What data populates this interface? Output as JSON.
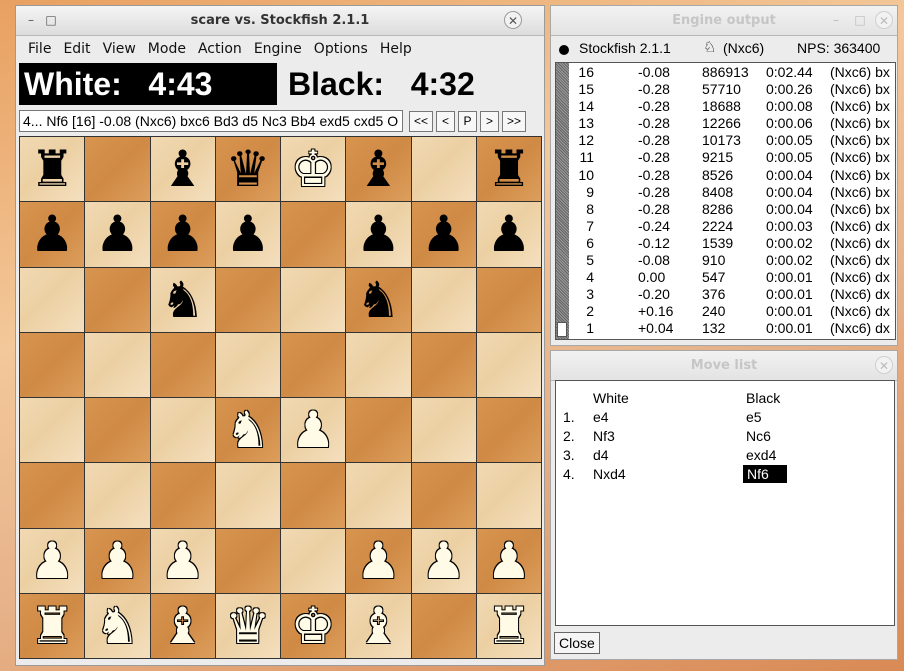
{
  "main_window": {
    "title": "scare vs. Stockfish 2.1.1",
    "menu": [
      "File",
      "Edit",
      "View",
      "Mode",
      "Action",
      "Engine",
      "Options",
      "Help"
    ],
    "white_clock": "White:   4:43",
    "black_clock": "Black:   4:32",
    "info_line": "4... Nf6  [16] -0.08  (Nxc6) bxc6 Bd3 d5 Nc3 Bb4 exd5 cxd5 O",
    "nav_buttons": [
      "<<",
      "<",
      "P",
      ">",
      ">>"
    ]
  },
  "board": {
    "ranks": [
      [
        "br",
        "",
        "bb",
        "bq",
        "wk_black_king",
        "bb",
        "",
        "br"
      ],
      [
        "bp",
        "bp",
        "bp",
        "bp",
        "",
        "bp",
        "bp",
        "bp"
      ],
      [
        "",
        "",
        "bn",
        "",
        "",
        "bn",
        "",
        ""
      ],
      [
        "",
        "",
        "",
        "",
        "",
        "",
        "",
        ""
      ],
      [
        "",
        "",
        "",
        "wn",
        "wp",
        "",
        "",
        ""
      ],
      [
        "",
        "",
        "",
        "",
        "",
        "",
        "",
        ""
      ],
      [
        "wp",
        "wp",
        "wp",
        "",
        "",
        "wp",
        "wp",
        "wp"
      ],
      [
        "wr",
        "wn",
        "wb",
        "wq",
        "wk",
        "wb",
        "",
        "wr"
      ]
    ]
  },
  "engine_output": {
    "title": "Engine output",
    "engine_name": "Stockfish 2.1.1",
    "current_move": "(Nxc6)",
    "nps": "NPS: 363400",
    "rows": [
      {
        "depth": "16",
        "score": "-0.08",
        "nodes": "886913",
        "time": "0:02.44",
        "pv": "(Nxc6) bx"
      },
      {
        "depth": "15",
        "score": "-0.28",
        "nodes": "57710",
        "time": "0:00.26",
        "pv": "(Nxc6) bx"
      },
      {
        "depth": "14",
        "score": "-0.28",
        "nodes": "18688",
        "time": "0:00.08",
        "pv": "(Nxc6) bx"
      },
      {
        "depth": "13",
        "score": "-0.28",
        "nodes": "12266",
        "time": "0:00.06",
        "pv": "(Nxc6) bx"
      },
      {
        "depth": "12",
        "score": "-0.28",
        "nodes": "10173",
        "time": "0:00.05",
        "pv": "(Nxc6) bx"
      },
      {
        "depth": "11",
        "score": "-0.28",
        "nodes": "9215",
        "time": "0:00.05",
        "pv": "(Nxc6) bx"
      },
      {
        "depth": "10",
        "score": "-0.28",
        "nodes": "8526",
        "time": "0:00.04",
        "pv": "(Nxc6) bx"
      },
      {
        "depth": "9",
        "score": "-0.28",
        "nodes": "8408",
        "time": "0:00.04",
        "pv": "(Nxc6) bx"
      },
      {
        "depth": "8",
        "score": "-0.28",
        "nodes": "8286",
        "time": "0:00.04",
        "pv": "(Nxc6) bx"
      },
      {
        "depth": "7",
        "score": "-0.24",
        "nodes": "2224",
        "time": "0:00.03",
        "pv": "(Nxc6) dx"
      },
      {
        "depth": "6",
        "score": "-0.12",
        "nodes": "1539",
        "time": "0:00.02",
        "pv": "(Nxc6) dx"
      },
      {
        "depth": "5",
        "score": "-0.08",
        "nodes": "910",
        "time": "0:00.02",
        "pv": "(Nxc6) dx"
      },
      {
        "depth": "4",
        "score": "0.00",
        "nodes": "547",
        "time": "0:00.01",
        "pv": "(Nxc6) dx"
      },
      {
        "depth": "3",
        "score": "-0.20",
        "nodes": "376",
        "time": "0:00.01",
        "pv": "(Nxc6) dx"
      },
      {
        "depth": "2",
        "score": "+0.16",
        "nodes": "240",
        "time": "0:00.01",
        "pv": "(Nxc6) dx"
      },
      {
        "depth": "1",
        "score": "+0.04",
        "nodes": "132",
        "time": "0:00.01",
        "pv": "(Nxc6) dx"
      }
    ]
  },
  "move_list": {
    "title": "Move list",
    "header_white": "White",
    "header_black": "Black",
    "moves": [
      {
        "num": "1.",
        "white": "e4",
        "black": "e5"
      },
      {
        "num": "2.",
        "white": "Nf3",
        "black": "Nc6"
      },
      {
        "num": "3.",
        "white": "d4",
        "black": "exd4"
      },
      {
        "num": "4.",
        "white": "Nxd4",
        "black": "Nf6"
      }
    ],
    "close_label": "Close"
  },
  "colors": {
    "light_square": "#f1d9b3",
    "dark_square": "#d8954f",
    "clock_active_bg": "#000000"
  }
}
